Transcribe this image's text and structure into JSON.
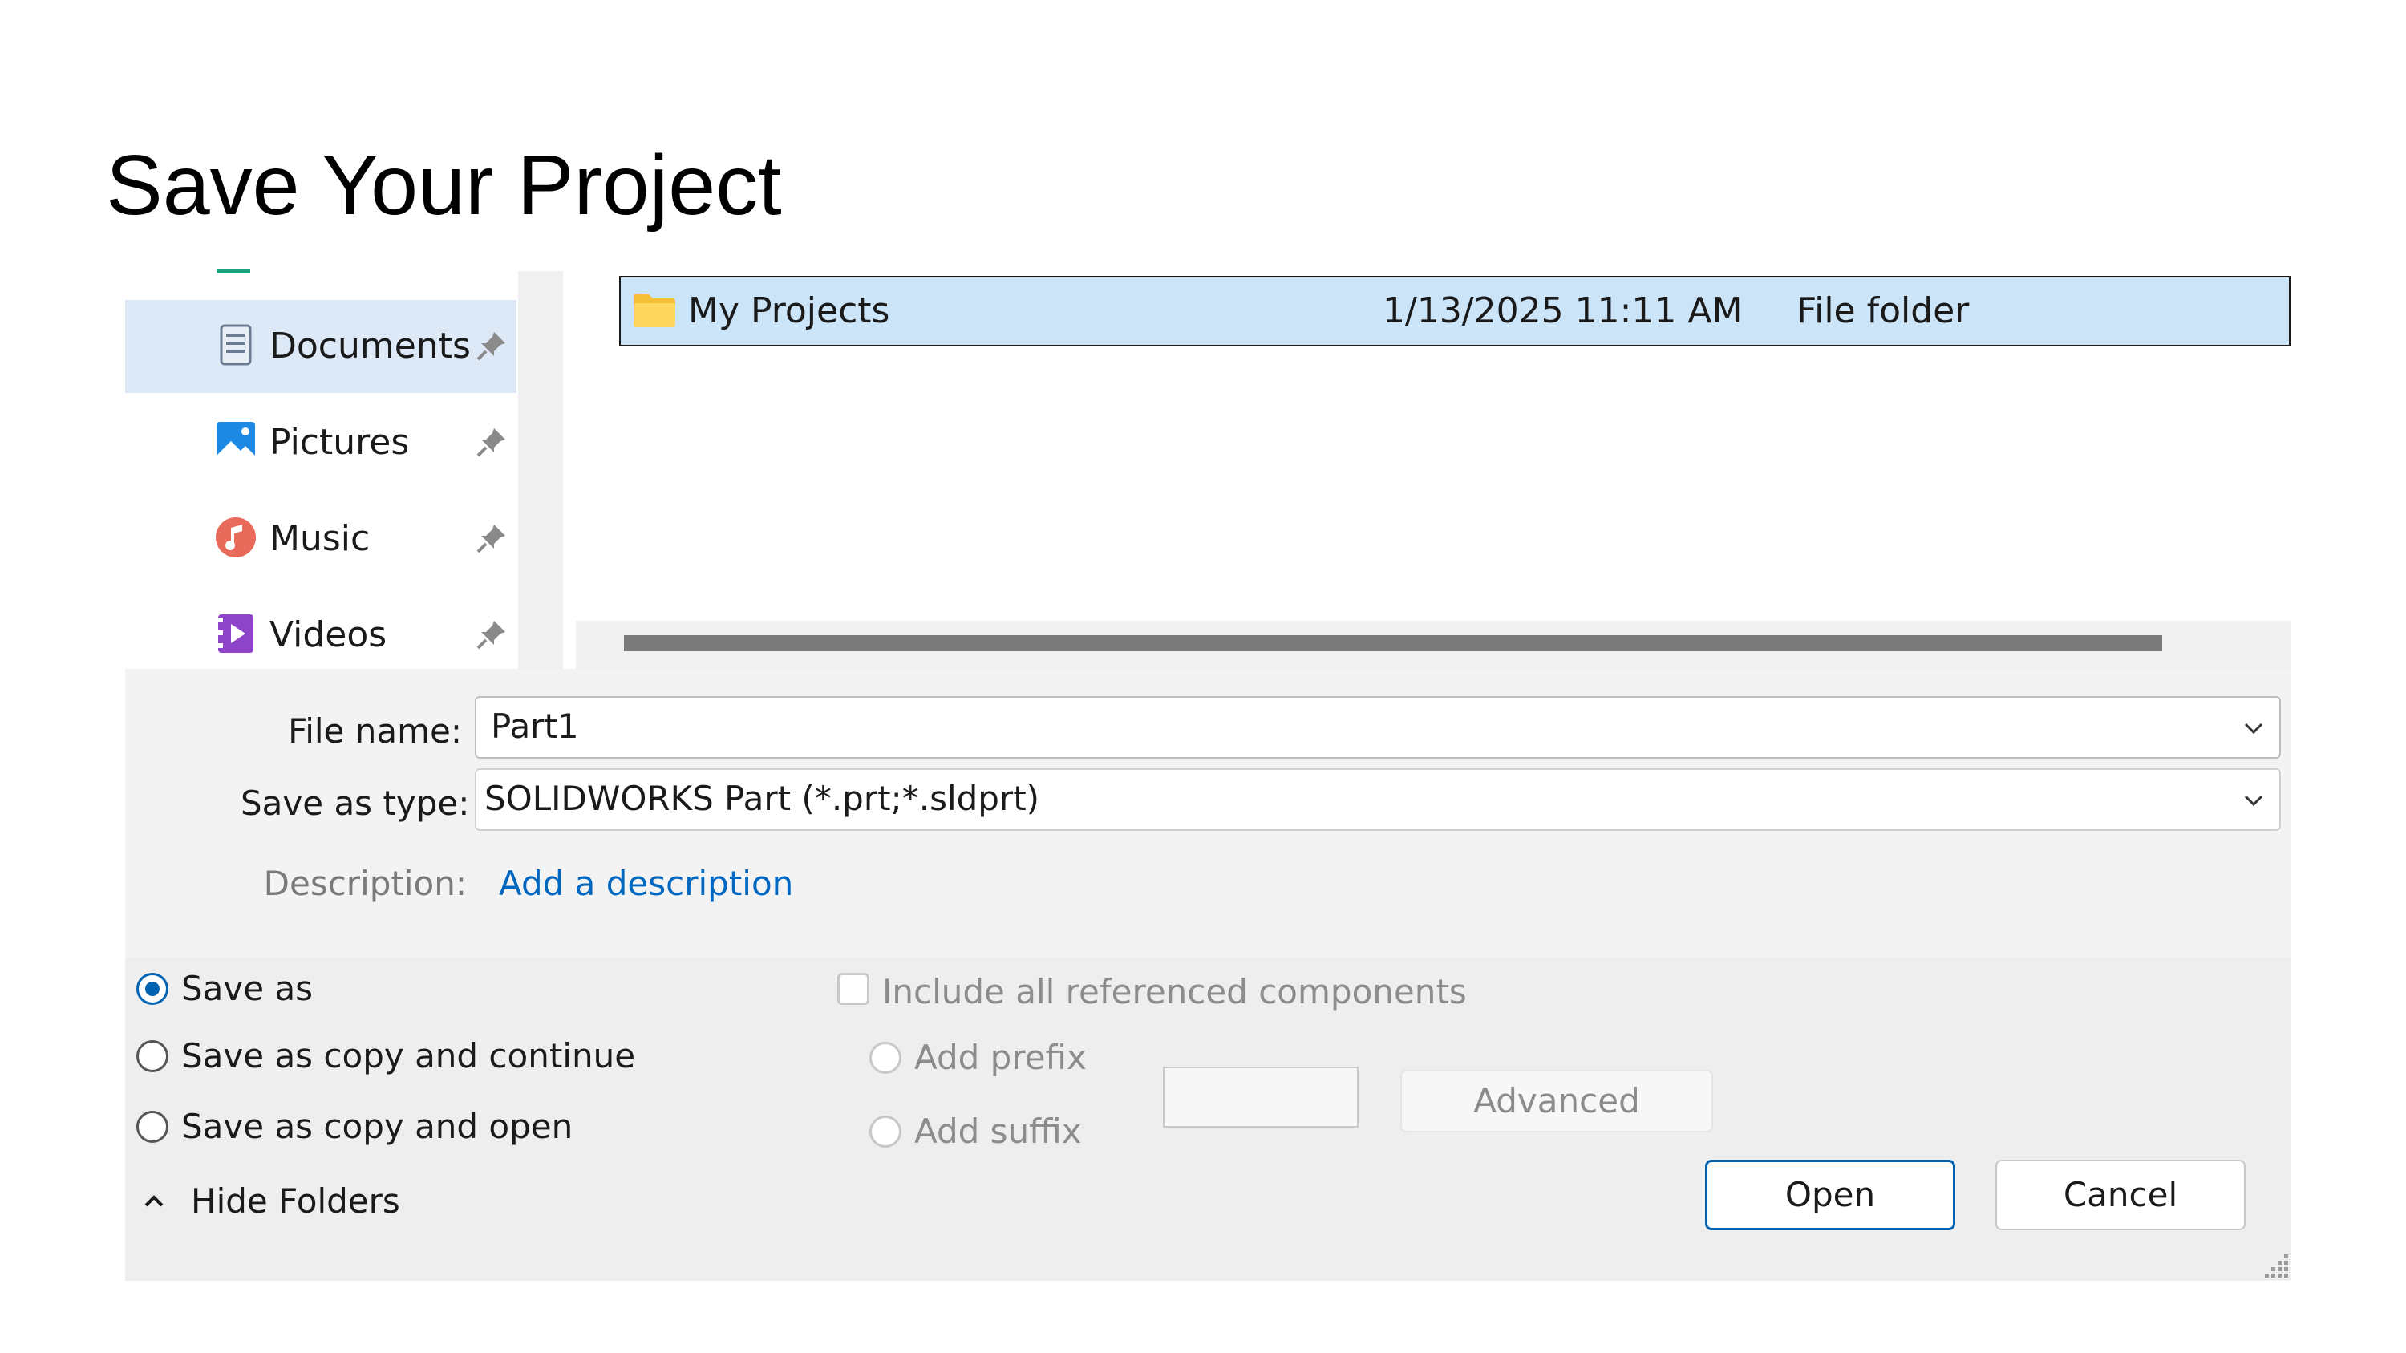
{
  "slide": {
    "title": "Save Your Project"
  },
  "nav": {
    "items": [
      {
        "label": "Documents",
        "icon": "documents-icon",
        "selected": true
      },
      {
        "label": "Pictures",
        "icon": "pictures-icon",
        "selected": false
      },
      {
        "label": "Music",
        "icon": "music-icon",
        "selected": false
      },
      {
        "label": "Videos",
        "icon": "videos-icon",
        "selected": false
      }
    ]
  },
  "file_list": {
    "rows": [
      {
        "name": "My Projects",
        "date_modified": "1/13/2025 11:11 AM",
        "type": "File folder",
        "icon": "folder-icon"
      }
    ]
  },
  "form": {
    "file_name_label": "File name:",
    "file_name_value": "Part1",
    "save_type_label": "Save as type:",
    "save_type_value": "SOLIDWORKS Part (*.prt;*.sldprt)",
    "description_label": "Description:",
    "description_link": "Add a description"
  },
  "options": {
    "save_as": "Save as",
    "save_copy_continue": "Save as copy and continue",
    "save_copy_open": "Save as copy and open",
    "include_refs": "Include all referenced components",
    "add_prefix": "Add prefix",
    "add_suffix": "Add suffix",
    "advanced": "Advanced",
    "hide_folders": "Hide Folders",
    "selected": "save_as"
  },
  "buttons": {
    "open": "Open",
    "cancel": "Cancel"
  },
  "colors": {
    "accent": "#0063b1",
    "selection": "#cce4f7",
    "nav_selected": "#dde9f7",
    "link": "#0067c0"
  }
}
